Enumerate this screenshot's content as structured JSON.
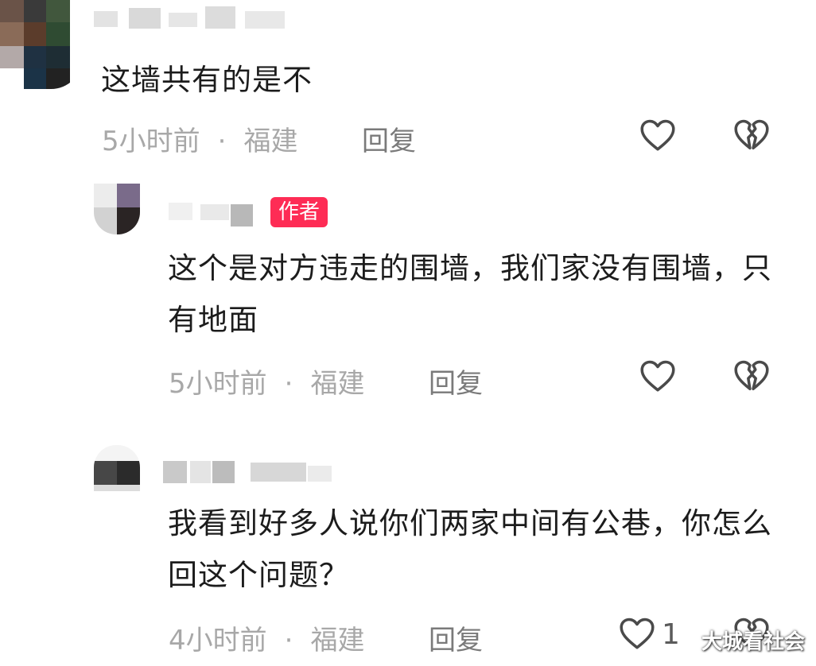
{
  "comments": [
    {
      "text": "这墙共有的是不",
      "time": "5小时前",
      "location": "福建",
      "reply_label": "回复"
    },
    {
      "badge": "作者",
      "text": "这个是对方违走的围墙，我们家没有围墙，只有地面",
      "time": "5小时前",
      "location": "福建",
      "reply_label": "回复"
    },
    {
      "text": "我看到好多人说你们两家中间有公巷，你怎么回这个问题？",
      "time": "4小时前",
      "location": "福建",
      "reply_label": "回复",
      "like_count": "1"
    }
  ],
  "separator": "·",
  "watermark": "大城看社会",
  "colors": {
    "badge": "#fe2c55",
    "meta": "#a8a8a8",
    "icon": "#4a4a4a"
  },
  "icons": {
    "like": "heart-outline-icon",
    "dislike": "broken-heart-icon"
  }
}
